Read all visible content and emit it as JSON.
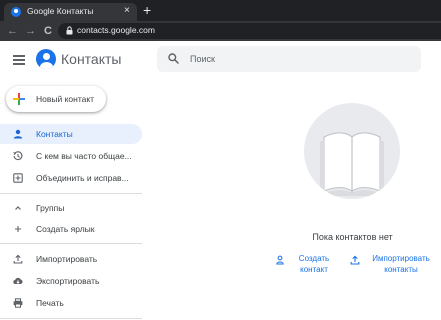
{
  "browser": {
    "tab_title": "Google Контакты",
    "tab_close": "×",
    "new_tab": "+",
    "back": "←",
    "forward": "→",
    "reload": "C",
    "url": "contacts.google.com"
  },
  "app": {
    "title": "Контакты",
    "search_placeholder": "Поиск",
    "brand_color": "#1a73e8"
  },
  "sidebar": {
    "create_label": "Новый контакт",
    "items": [
      {
        "label": "Контакты",
        "icon": "person-icon",
        "active": true
      },
      {
        "label": "С кем вы часто общае...",
        "icon": "history-icon",
        "active": false
      },
      {
        "label": "Объединить и исправ...",
        "icon": "merge-icon",
        "active": false
      }
    ],
    "labels_header": "Группы",
    "create_label_item": "Создать ярлык",
    "tools": [
      {
        "label": "Импортировать",
        "icon": "upload-icon"
      },
      {
        "label": "Экспортировать",
        "icon": "cloud-download-icon"
      },
      {
        "label": "Печать",
        "icon": "printer-icon"
      }
    ]
  },
  "empty_state": {
    "message": "Пока контактов нет",
    "create_action": {
      "line1": "Создать",
      "line2": "контакт"
    },
    "import_action": {
      "line1": "Импортировать",
      "line2": "контакты"
    }
  }
}
